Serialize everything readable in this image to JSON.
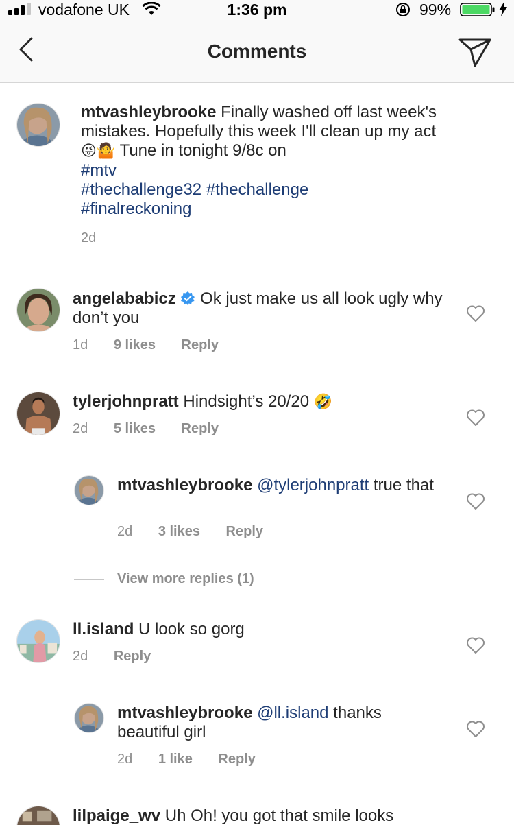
{
  "status_bar": {
    "carrier": "vodafone UK",
    "time": "1:36 pm",
    "battery": "99%"
  },
  "header": {
    "title": "Comments"
  },
  "caption": {
    "username": "mtvashleybrooke",
    "text_1": "Finally washed off last week's mistakes. Hopefully this week I'll clean up my act",
    "emojis": "😜🤷",
    "text_2": "Tune in tonight 9/8c on",
    "hashtags_line1": "#mtv",
    "hashtags_line2": "#thechallenge32 #thechallenge",
    "hashtags_line3": "#finalreckoning",
    "time": "2d"
  },
  "comments": [
    {
      "username": "angelababicz",
      "verified": true,
      "text": "Ok just make us all look ugly why don’t you",
      "time": "1d",
      "likes": "9 likes",
      "reply": "Reply"
    },
    {
      "username": "tylerjohnpratt",
      "text": "Hindsight’s 20/20",
      "emoji": "🤣",
      "time": "2d",
      "likes": "5 likes",
      "reply": "Reply",
      "replies": [
        {
          "username": "mtvashleybrooke",
          "mention": "@tylerjohnpratt",
          "text": "true that",
          "time": "2d",
          "likes": "3 likes",
          "reply": "Reply"
        }
      ],
      "view_more": "View more replies (1)"
    },
    {
      "username": "ll.island",
      "text": "U look so gorg",
      "time": "2d",
      "reply": "Reply",
      "replies": [
        {
          "username": "mtvashleybrooke",
          "mention": "@ll.island",
          "text": "thanks beautiful girl",
          "time": "2d",
          "likes": "1 like",
          "reply": "Reply"
        }
      ]
    },
    {
      "username": "lilpaige_wv",
      "text": "Uh Oh! you got that smile looks"
    }
  ],
  "colors": {
    "link": "#1e3d75",
    "meta": "#8e8e8e",
    "verified": "#3897f0",
    "battery": "#4cd964"
  }
}
